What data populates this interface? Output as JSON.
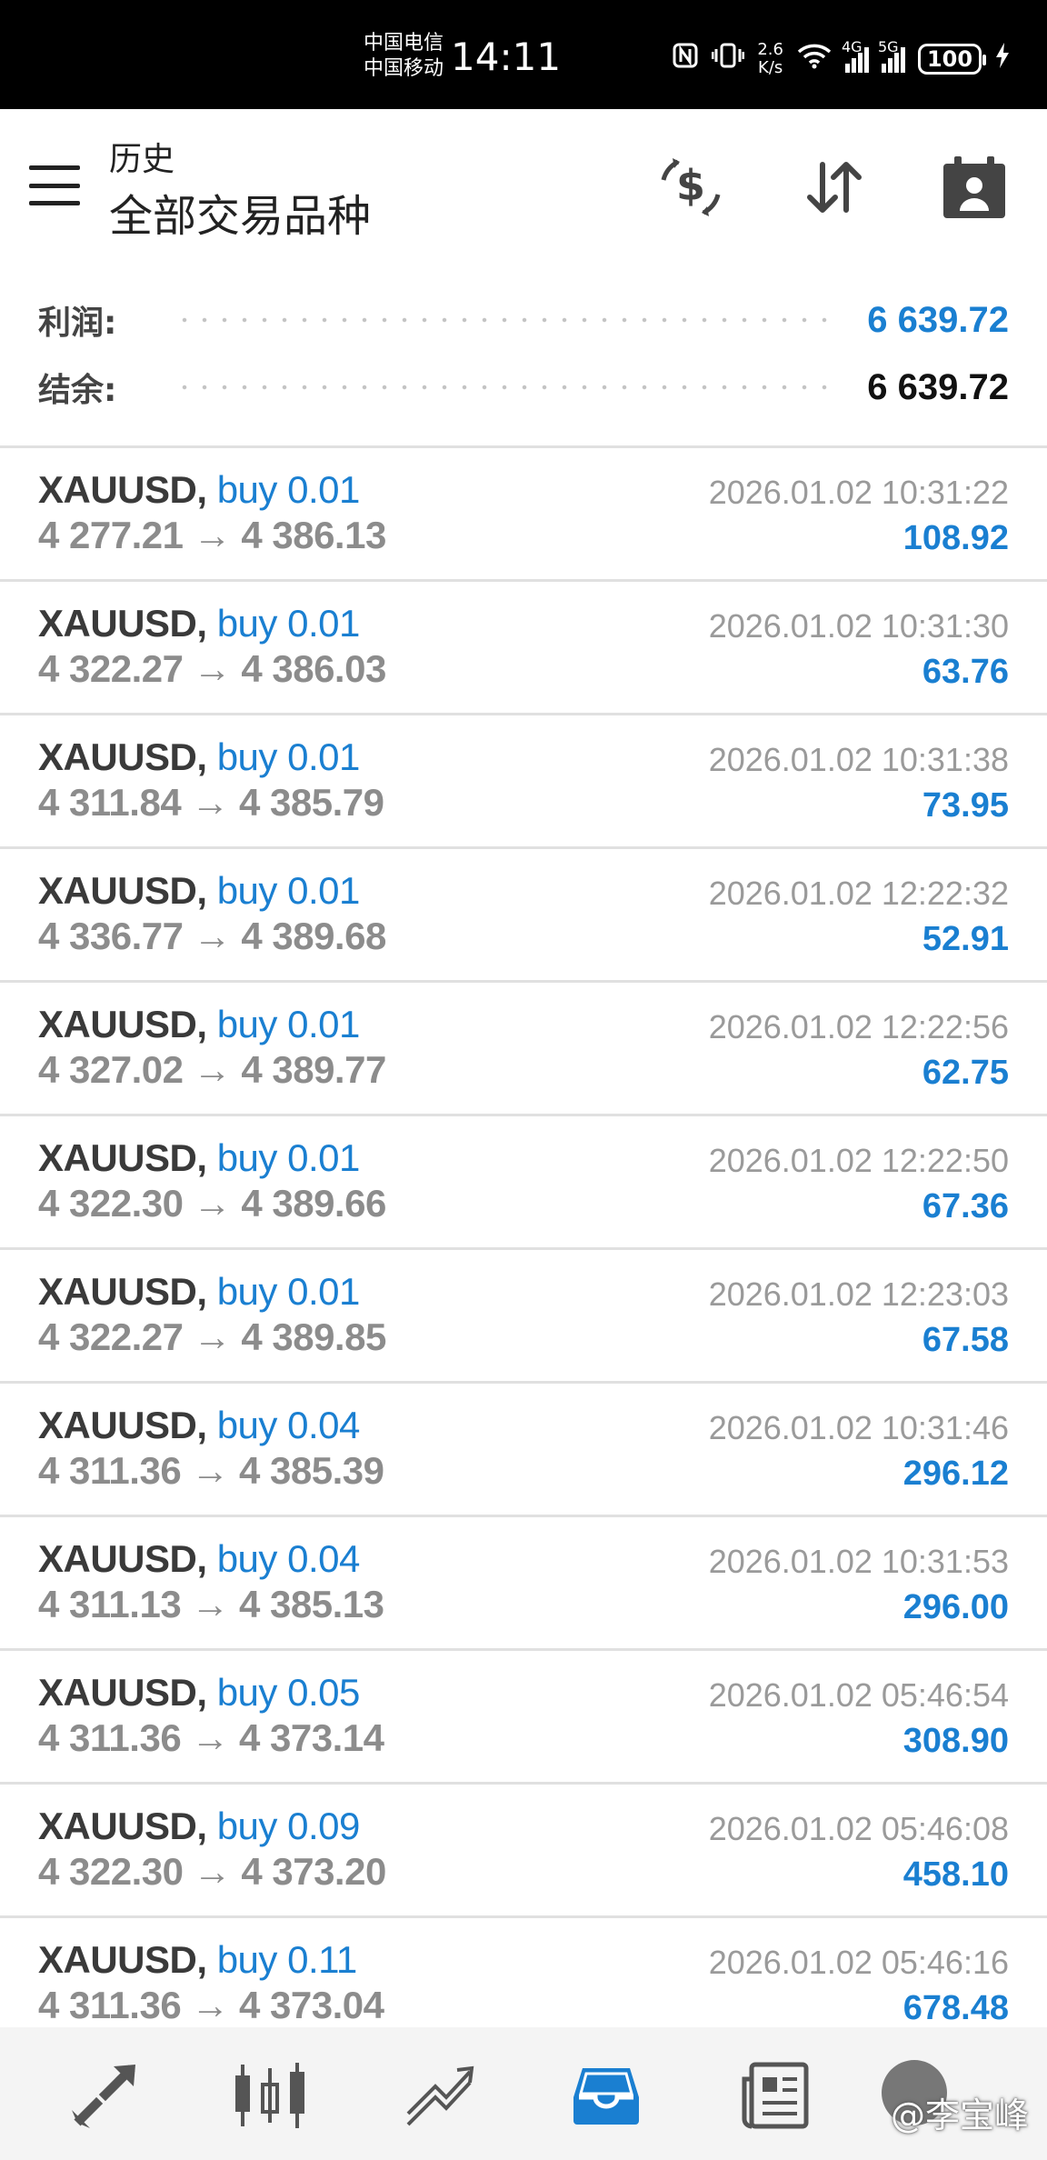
{
  "status_bar": {
    "carrier_1": "中国电信",
    "carrier_2": "中国移动",
    "time": "14:11",
    "net_speed_value": "2.6",
    "net_speed_unit": "K/s",
    "signal_1_label": "4G",
    "signal_2_label": "5G",
    "battery": "100"
  },
  "header": {
    "subtitle": "历史",
    "title": "全部交易品种"
  },
  "summary": {
    "profit_label": "利润:",
    "profit_value": "6 639.72",
    "balance_label": "结余:",
    "balance_value": "6 639.72",
    "profit_color": "#1a7fd1",
    "balance_color": "#111111"
  },
  "trades": [
    {
      "symbol": "XAUUSD,",
      "side": "buy 0.01",
      "prices": "4 277.21 → 4 386.13",
      "time": "2026.01.02 10:31:22",
      "profit": "108.92"
    },
    {
      "symbol": "XAUUSD,",
      "side": "buy 0.01",
      "prices": "4 322.27 → 4 386.03",
      "time": "2026.01.02 10:31:30",
      "profit": "63.76"
    },
    {
      "symbol": "XAUUSD,",
      "side": "buy 0.01",
      "prices": "4 311.84 → 4 385.79",
      "time": "2026.01.02 10:31:38",
      "profit": "73.95"
    },
    {
      "symbol": "XAUUSD,",
      "side": "buy 0.01",
      "prices": "4 336.77 → 4 389.68",
      "time": "2026.01.02 12:22:32",
      "profit": "52.91"
    },
    {
      "symbol": "XAUUSD,",
      "side": "buy 0.01",
      "prices": "4 327.02 → 4 389.77",
      "time": "2026.01.02 12:22:56",
      "profit": "62.75"
    },
    {
      "symbol": "XAUUSD,",
      "side": "buy 0.01",
      "prices": "4 322.30 → 4 389.66",
      "time": "2026.01.02 12:22:50",
      "profit": "67.36"
    },
    {
      "symbol": "XAUUSD,",
      "side": "buy 0.01",
      "prices": "4 322.27 → 4 389.85",
      "time": "2026.01.02 12:23:03",
      "profit": "67.58"
    },
    {
      "symbol": "XAUUSD,",
      "side": "buy 0.04",
      "prices": "4 311.36 → 4 385.39",
      "time": "2026.01.02 10:31:46",
      "profit": "296.12"
    },
    {
      "symbol": "XAUUSD,",
      "side": "buy 0.04",
      "prices": "4 311.13 → 4 385.13",
      "time": "2026.01.02 10:31:53",
      "profit": "296.00"
    },
    {
      "symbol": "XAUUSD,",
      "side": "buy 0.05",
      "prices": "4 311.36 → 4 373.14",
      "time": "2026.01.02 05:46:54",
      "profit": "308.90"
    },
    {
      "symbol": "XAUUSD,",
      "side": "buy 0.09",
      "prices": "4 322.30 → 4 373.20",
      "time": "2026.01.02 05:46:08",
      "profit": "458.10"
    },
    {
      "symbol": "XAUUSD,",
      "side": "buy 0.11",
      "prices": "4 311.36 → 4 373.04",
      "time": "2026.01.02 05:46:16",
      "profit": "678.48"
    }
  ],
  "bottom_nav": {
    "items": [
      {
        "icon": "quotes-arrows-icon",
        "active": false
      },
      {
        "icon": "candlestick-chart-icon",
        "active": false
      },
      {
        "icon": "trade-lines-icon",
        "active": false
      },
      {
        "icon": "history-inbox-icon",
        "active": true
      },
      {
        "icon": "news-document-icon",
        "active": false
      }
    ],
    "active_color": "#1a7fd1",
    "inactive_color": "#555555"
  },
  "watermark": "@李宝峰",
  "icons": {
    "menu": "hamburger-menu-icon",
    "currency": "currency-exchange-icon",
    "sort": "sort-arrows-icon",
    "calendar": "calendar-person-icon"
  }
}
